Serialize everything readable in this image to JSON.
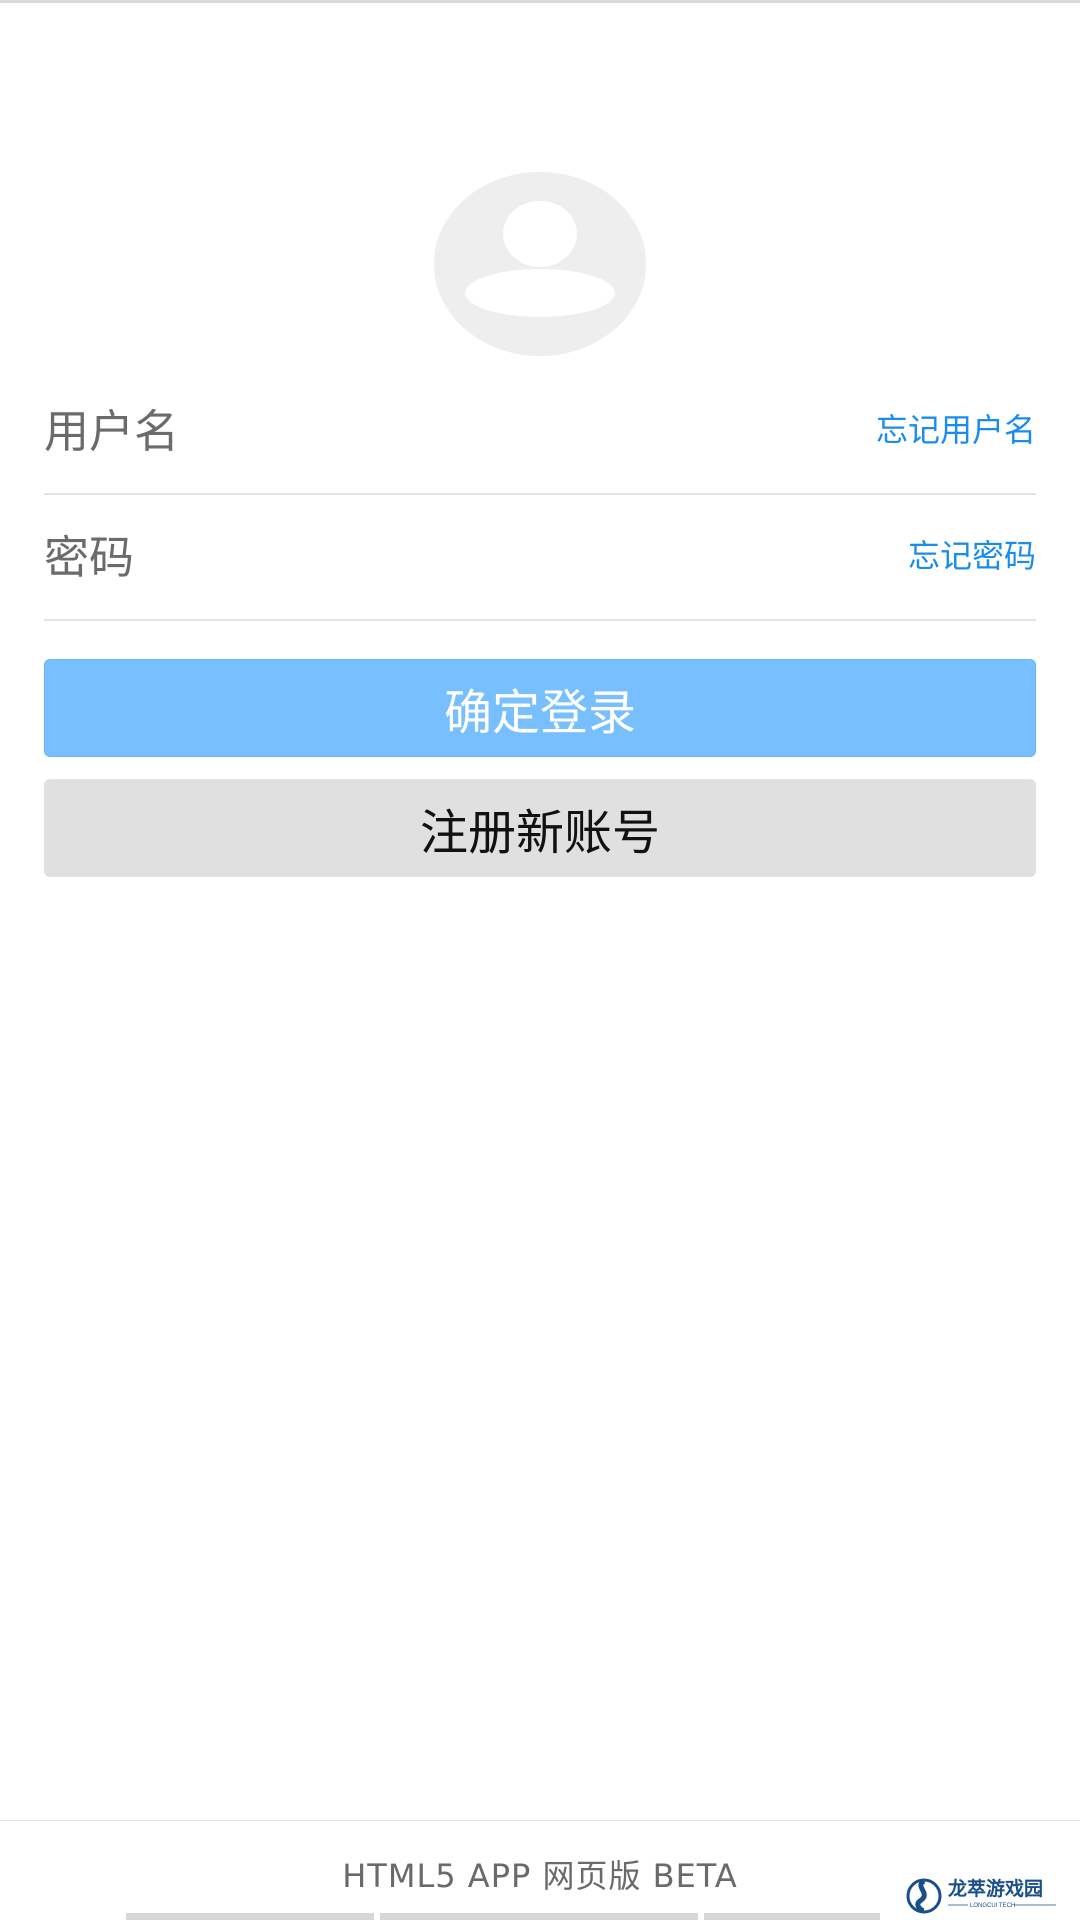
{
  "login": {
    "username_placeholder": "用户名",
    "forgot_username": "忘记用户名",
    "password_placeholder": "密码",
    "forgot_password": "忘记密码",
    "login_button": "确定登录",
    "register_button": "注册新账号"
  },
  "footer": {
    "text": "HTML5 APP 网页版 BETA"
  },
  "watermark": {
    "brand_text": "龙萃游戏园",
    "sub_text": "LONGCUI TECH"
  },
  "colors": {
    "link": "#1a8cf0",
    "primary_button": "#77bfff",
    "secondary_button": "#e0e0e0",
    "avatar": "#eeeeee"
  },
  "icons": {
    "avatar": "user-avatar-icon"
  }
}
